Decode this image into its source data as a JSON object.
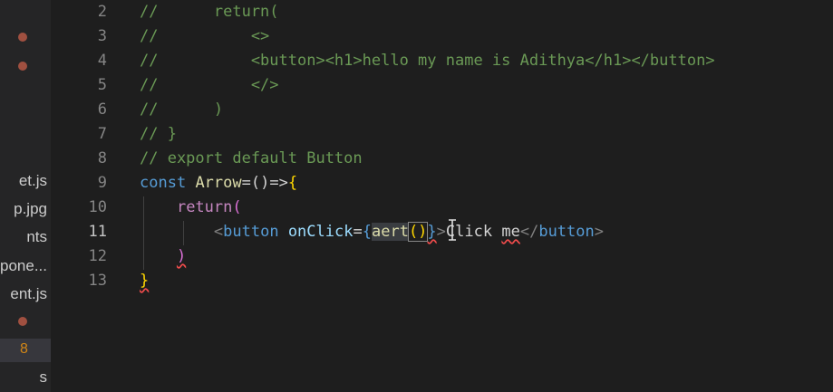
{
  "sidebar": {
    "items": [
      {
        "label": "et.js"
      },
      {
        "label": "p.jpg"
      },
      {
        "label": "nts"
      },
      {
        "label": "pone..."
      },
      {
        "label": "ent.js"
      },
      {
        "label": "s"
      }
    ],
    "badge": "8"
  },
  "editor": {
    "active_line": "11",
    "lines": [
      {
        "n": "2",
        "t": "//      return("
      },
      {
        "n": "3",
        "t": "//          <>"
      },
      {
        "n": "4",
        "t": "//          <button><h1>hello my name is Adithya</h1></button>"
      },
      {
        "n": "5",
        "t": "//          </>"
      },
      {
        "n": "6",
        "t": "//      )"
      },
      {
        "n": "7",
        "t": "// }"
      },
      {
        "n": "8",
        "t": "// export default Button"
      },
      {
        "n": "9",
        "kw": "const",
        "name": "Arrow",
        "rest": "=()=>"
      },
      {
        "n": "10",
        "ret": "return"
      },
      {
        "n": "11",
        "tag_open": "button",
        "attr": "onClick",
        "fn_a": "a",
        "fn_b": "ert",
        "text": "Click",
        "text2": "me",
        "tag_close": "button"
      },
      {
        "n": "12"
      },
      {
        "n": "13"
      }
    ]
  },
  "colors": {
    "background": "#1e1e1e",
    "comment": "#6a9955",
    "keyword": "#569cd6"
  }
}
